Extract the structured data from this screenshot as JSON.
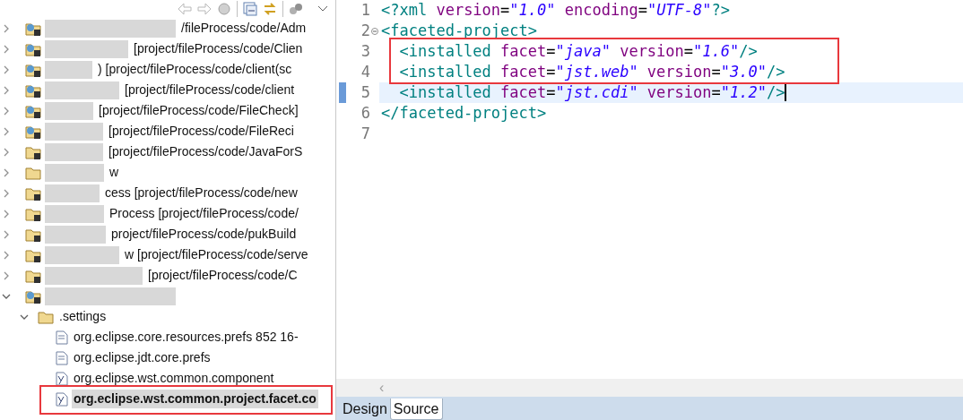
{
  "explorer": {
    "tree": [
      {
        "label": "/fileProcess/code/Adm",
        "expanded": false,
        "kind": "web"
      },
      {
        "label": "[project/fileProcess/code/Clien",
        "expanded": false,
        "kind": "web"
      },
      {
        "label": ") [project/fileProcess/code/client(sc",
        "expanded": false,
        "kind": "web"
      },
      {
        "label": "[project/fileProcess/code/client",
        "expanded": false,
        "kind": "web"
      },
      {
        "label": "[project/fileProcess/code/FileCheck]",
        "expanded": false,
        "kind": "web"
      },
      {
        "label": "[project/fileProcess/code/FileReci",
        "expanded": false,
        "kind": "web"
      },
      {
        "label": "[project/fileProcess/code/JavaForS",
        "expanded": false,
        "kind": "project"
      },
      {
        "label": "w",
        "expanded": false,
        "kind": "folder"
      },
      {
        "label": "cess [project/fileProcess/code/new",
        "expanded": false,
        "kind": "project"
      },
      {
        "label": "Process [project/fileProcess/code/",
        "expanded": false,
        "kind": "project"
      },
      {
        "label": "project/fileProcess/code/pukBuild",
        "expanded": false,
        "kind": "project"
      },
      {
        "label": "w [project/fileProcess/code/serve",
        "expanded": false,
        "kind": "project"
      },
      {
        "label": "[project/fileProcess/code/C",
        "expanded": false,
        "kind": "project"
      },
      {
        "expanded": true,
        "kind": "web",
        "children": [
          {
            "label": ".settings",
            "expanded": true,
            "kind": "folder",
            "children": [
              {
                "label": "org.eclipse.core.resources.prefs 852  16-",
                "kind": "file",
                "selected": false
              },
              {
                "label": "org.eclipse.jdt.core.prefs",
                "kind": "file",
                "selected": false
              },
              {
                "label": "org.eclipse.wst.common.component",
                "kind": "xmlfile",
                "selected": false
              },
              {
                "label": "org.eclipse.wst.common.project.facet.co",
                "kind": "xmlfile",
                "selected": true
              }
            ]
          }
        ]
      }
    ]
  },
  "editor": {
    "lines": [
      {
        "number": "1",
        "current": false,
        "tokens": [
          {
            "tag": "<?xml"
          },
          {
            "attr": " version"
          },
          {
            "eq": "="
          },
          {
            "val": "\"1.0\""
          },
          {
            "attr": " encoding"
          },
          {
            "eq": "="
          },
          {
            "val": "\"UTF-8\""
          },
          {
            "tag": "?>"
          }
        ]
      },
      {
        "number": "2",
        "current": false,
        "fold": true,
        "tokens": [
          {
            "tag": "<faceted-project>"
          }
        ]
      },
      {
        "number": "3",
        "current": false,
        "tokens": [
          {
            "tag": "  <installed"
          },
          {
            "attr": " facet"
          },
          {
            "eq": "="
          },
          {
            "val": "\"java\""
          },
          {
            "attr": " version"
          },
          {
            "eq": "="
          },
          {
            "val": "\"1.6\""
          },
          {
            "tag": "/>"
          }
        ]
      },
      {
        "number": "4",
        "current": false,
        "tokens": [
          {
            "tag": "  <installed"
          },
          {
            "attr": " facet"
          },
          {
            "eq": "="
          },
          {
            "val": "\"jst.web\""
          },
          {
            "attr": " version"
          },
          {
            "eq": "="
          },
          {
            "val": "\"3.0\""
          },
          {
            "tag": "/>"
          }
        ]
      },
      {
        "number": "5",
        "current": true,
        "tokens": [
          {
            "tag": "  <installed"
          },
          {
            "attr": " facet"
          },
          {
            "eq": "="
          },
          {
            "val": "\"jst.cdi\""
          },
          {
            "attr": " version"
          },
          {
            "eq": "="
          },
          {
            "val": "\"1.2\""
          },
          {
            "tag": "/>"
          }
        ]
      },
      {
        "number": "6",
        "current": false,
        "tokens": [
          {
            "tag": "</faceted-project>"
          }
        ]
      },
      {
        "number": "7",
        "current": false
      }
    ],
    "scroll_left": "‹"
  },
  "tabs": [
    {
      "label": "Design",
      "selected": false
    },
    {
      "label": "Source",
      "selected": true
    }
  ]
}
